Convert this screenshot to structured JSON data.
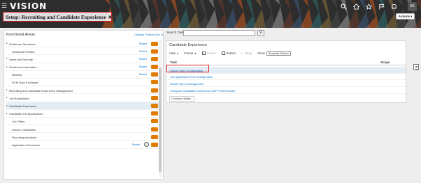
{
  "header": {
    "logo": "VISION",
    "menu_icon": "hamburger-icon",
    "icons": [
      "search-icon",
      "home-icon",
      "star-icon",
      "flag-icon",
      "bell-icon"
    ],
    "avatar_initials": "SK",
    "colors": {
      "banner": "#2a2a2a",
      "highlight": "#d71920",
      "accent": "#e07b00",
      "link": "#0572ce"
    }
  },
  "page": {
    "title": "Setup: Recruiting and Candidate Experience",
    "actions_label": "Actions"
  },
  "functional_areas": {
    "title": "Functional Areas",
    "change_link": "Change Feature Opt In",
    "rows": [
      {
        "label": "Workforce Structures",
        "shared": "Shared",
        "expandable": true,
        "selected": false
      },
      {
        "label": "Workforce Profiles",
        "shared": "Shared",
        "expandable": false,
        "selected": false
      },
      {
        "label": "Users and Security",
        "shared": "Shared",
        "expandable": true,
        "selected": false
      },
      {
        "label": "Workforce Information",
        "shared": "Shared",
        "expandable": true,
        "selected": false
      },
      {
        "label": "Benefits",
        "shared": "Shared",
        "expandable": false,
        "selected": false
      },
      {
        "label": "HCM Data Exchange",
        "shared": "",
        "expandable": false,
        "selected": false
      },
      {
        "label": "Recruiting and Candidate Experience Management",
        "shared": "",
        "expandable": true,
        "selected": false
      },
      {
        "label": "Job Requisitions",
        "shared": "",
        "expandable": true,
        "selected": false
      },
      {
        "label": "Candidate Experience",
        "shared": "",
        "expandable": true,
        "selected": true
      },
      {
        "label": "Candidate Job Applications",
        "shared": "",
        "expandable": true,
        "selected": false
      },
      {
        "label": "Job Offers",
        "shared": "",
        "expandable": false,
        "selected": false
      },
      {
        "label": "Source Candidates",
        "shared": "",
        "expandable": false,
        "selected": false
      },
      {
        "label": "Recruiting Assistant",
        "shared": "",
        "expandable": false,
        "selected": false
      },
      {
        "label": "Application Extensions",
        "shared": "Shared",
        "expandable": false,
        "selected": false,
        "help": "?"
      }
    ]
  },
  "search": {
    "label": "Search Tasks",
    "value": ""
  },
  "tasks_panel": {
    "title": "Candidate Experience",
    "toolbar": {
      "view": "View",
      "format": "Format",
      "freeze": "Freeze",
      "detach": "Detach",
      "wrap": "Wrap",
      "show": "Show",
      "show_value": "Required Tasks"
    },
    "columns": {
      "task": "Task",
      "scope": "Scope"
    },
    "tasks": [
      {
        "label": "Career Sites Configuration",
        "selected": true
      },
      {
        "label": "Job Application Flow Configuration",
        "selected": false
      },
      {
        "label": "Oracle Opt-In Management",
        "selected": false
      },
      {
        "label": "Configure Candidate Experience CAPTCHA Provider",
        "selected": false
      }
    ],
    "columns_hidden": "Columns Hidden"
  }
}
